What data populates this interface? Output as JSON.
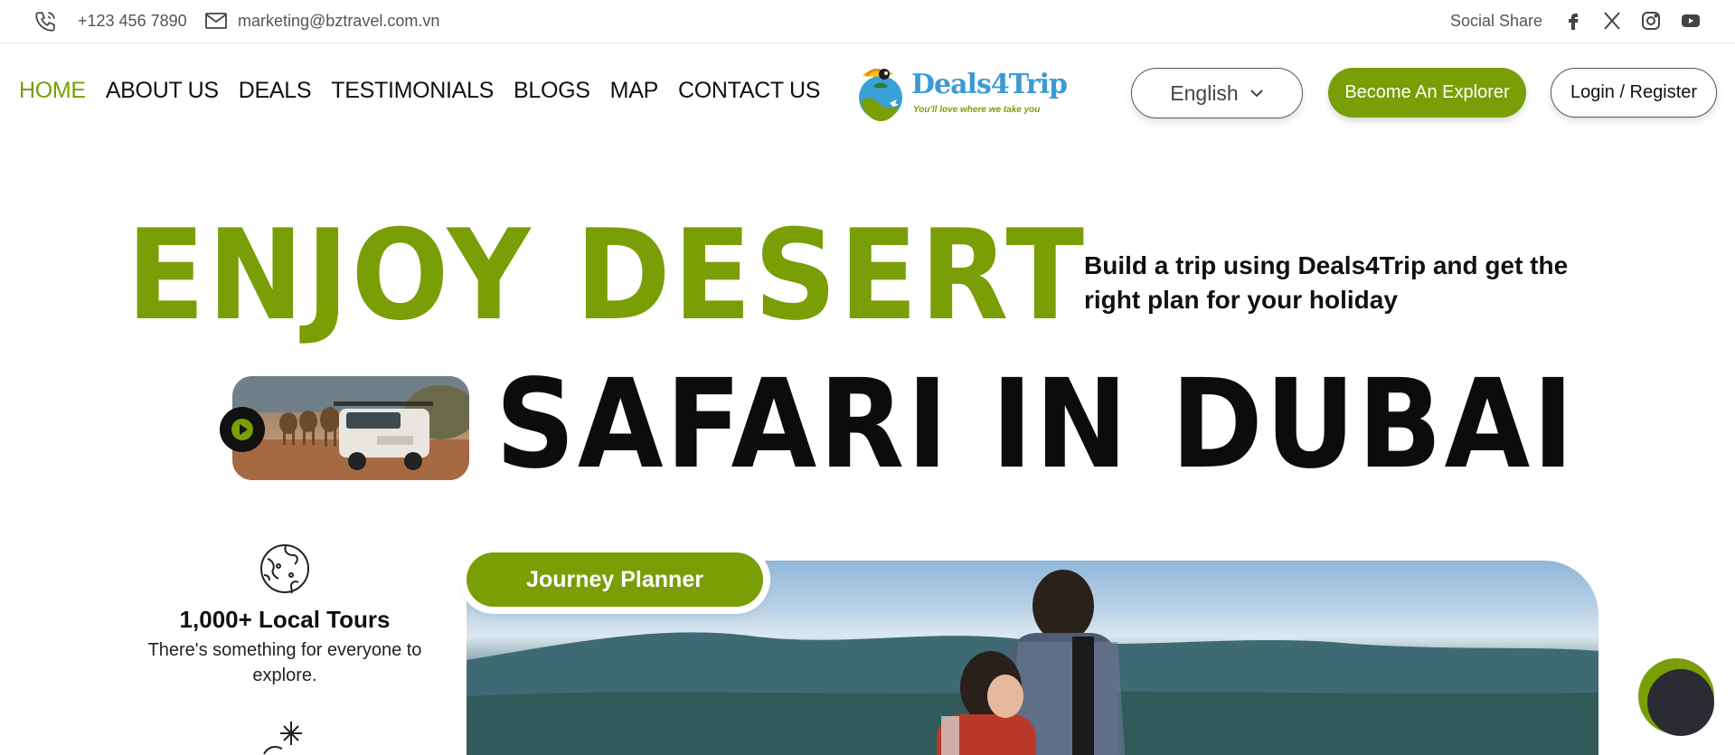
{
  "topbar": {
    "phone": "+123 456 7890",
    "email": "marketing@bztravel.com.vn",
    "social_label": "Social Share",
    "social_icons": [
      "facebook-icon",
      "x-icon",
      "instagram-icon",
      "youtube-icon"
    ]
  },
  "nav": {
    "links": [
      "HOME",
      "ABOUT US",
      "DEALS",
      "TESTIMONIALS",
      "BLOGS",
      "MAP",
      "CONTACT US"
    ],
    "active": "HOME"
  },
  "logo": {
    "name": "Deals4Trip",
    "tagline": "You'll love where we take you"
  },
  "header_actions": {
    "language": "English",
    "explorer_label": "Become An Explorer",
    "login_label": "Login / Register"
  },
  "hero": {
    "line1": "ENJOY DESERT",
    "line2": "SAFARI IN DUBAI",
    "description": "Build a trip using Deals4Trip and get the right plan for your holiday"
  },
  "features": [
    {
      "icon": "globe-icon",
      "title": "1,000+ Local Tours",
      "text": "There's something for everyone to explore."
    },
    {
      "icon": "snowflake-icon"
    }
  ],
  "journey": {
    "label": "Journey Planner"
  },
  "colors": {
    "accent": "#7a9e06",
    "text": "#111111",
    "chat": "#2a2b33"
  }
}
